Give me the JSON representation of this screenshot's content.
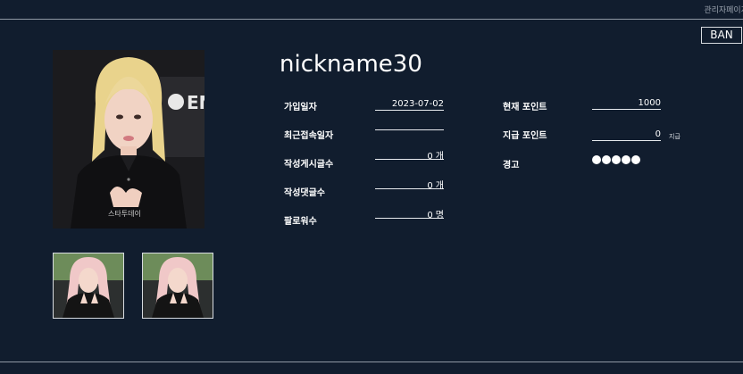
{
  "header": {
    "admin_link": "관리자페이지"
  },
  "actions": {
    "ban_label": "BAN"
  },
  "profile": {
    "nickname": "nickname30"
  },
  "stats": {
    "join_date": {
      "label": "가입일자",
      "value": "2023-07-02"
    },
    "last_login": {
      "label": "최근접속일자",
      "value": ""
    },
    "posts": {
      "label": "작성게시글수",
      "value": "0",
      "unit": "개"
    },
    "comments": {
      "label": "작성댓글수",
      "value": "0",
      "unit": "개"
    },
    "followers": {
      "label": "팔로워수",
      "value": "0",
      "unit": "명"
    }
  },
  "points": {
    "current": {
      "label": "현재 포인트",
      "value": "1000"
    },
    "grant": {
      "label": "지급 포인트",
      "value": "0",
      "action": "지급"
    },
    "warnings": {
      "label": "경고",
      "level": 5,
      "max": 5
    }
  },
  "colors": {
    "background": "#111d2e",
    "text": "#ffffff",
    "line": "#8f98a4"
  }
}
